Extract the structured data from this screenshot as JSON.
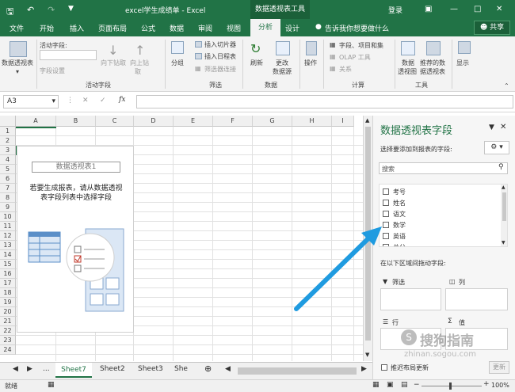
{
  "titlebar": {
    "title": "excel学生成绩单 - Excel",
    "context_tab": "数据透视表工具",
    "login": "登录",
    "share": "共享"
  },
  "menu": {
    "file": "文件",
    "home": "开始",
    "insert": "插入",
    "layout": "页面布局",
    "formula": "公式",
    "data": "数据",
    "review": "审阅",
    "view": "视图",
    "analyze": "分析",
    "design": "设计",
    "tellme": "告诉我你想要做什么"
  },
  "ribbon": {
    "pivot_table": "数据透视表",
    "active_field_label": "活动字段:",
    "field_settings": "字段设置",
    "drill_down": "向下钻取",
    "drill_up": "向上钻",
    "drill_up2": "取",
    "group_label": "活动字段",
    "group": "分组",
    "insert_slicer": "插入切片器",
    "insert_timeline": "插入日程表",
    "filter_connections": "筛选器连接",
    "filter_group": "筛选",
    "refresh": "刷新",
    "change_source": "更改",
    "change_source2": "数据源",
    "data_group": "数据",
    "actions": "操作",
    "fields_items": "字段、项目和集",
    "olap": "OLAP 工具",
    "relations": "关系",
    "calc_group": "计算",
    "pivot_chart": "数据",
    "pivot_chart2": "透视图",
    "recommended": "推荐的数",
    "recommended2": "据透视表",
    "tools_group": "工具",
    "show": "显示"
  },
  "formulabar": {
    "namebox": "A3",
    "fx": "fx"
  },
  "grid": {
    "columns": [
      "A",
      "B",
      "C",
      "D",
      "E",
      "F",
      "G",
      "H",
      "I"
    ],
    "rows": [
      "1",
      "2",
      "3",
      "4",
      "5",
      "6",
      "7",
      "8",
      "9",
      "10",
      "11",
      "12",
      "13",
      "14",
      "15",
      "16",
      "17",
      "18",
      "19",
      "20",
      "21",
      "22",
      "23",
      "24"
    ]
  },
  "placeholder": {
    "title": "数据透视表1",
    "line1": "若要生成报表，请从数据透视",
    "line2": "表字段列表中选择字段"
  },
  "sheets": {
    "tabs": [
      "Sheet7",
      "Sheet2",
      "Sheet3",
      "She"
    ],
    "ellipsis": "..."
  },
  "panel": {
    "title": "数据透视表字段",
    "subtitle": "选择要添加到报表的字段:",
    "search_placeholder": "搜索",
    "fields": [
      "考号",
      "姓名",
      "语文",
      "数学",
      "英语",
      "总分"
    ],
    "drag_label": "在以下区域间拖动字段:",
    "filters": "筛选",
    "columns": "列",
    "rows": "行",
    "values": "值",
    "defer": "推迟布局更新",
    "update": "更新"
  },
  "status": {
    "ready": "就绪",
    "zoom": "100%"
  },
  "watermark": {
    "text": "搜狗指南",
    "url": "zhinan.sogou.com"
  }
}
